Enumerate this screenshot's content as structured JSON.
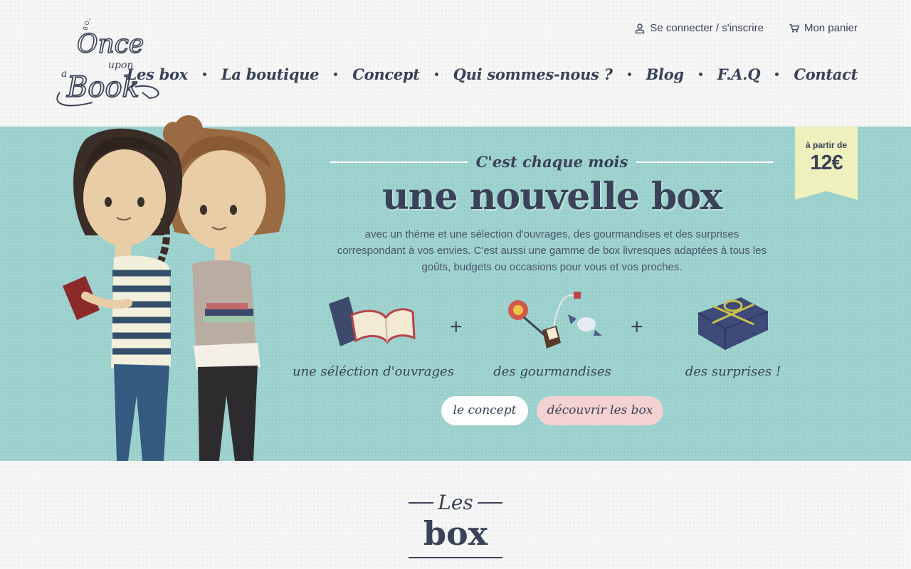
{
  "logo": {
    "tagline": "BOX LIVRESQUE",
    "line1": "Once",
    "line2": "upon",
    "line3": "a",
    "line4": "Book",
    "icon": "once-upon-a-book-logo"
  },
  "top_links": {
    "login": {
      "label": "Se connecter / s'inscrire",
      "icon": "user-icon"
    },
    "cart": {
      "label": "Mon panier",
      "icon": "cart-icon"
    }
  },
  "nav": [
    "Les box",
    "La boutique",
    "Concept",
    "Qui sommes-nous ?",
    "Blog",
    "F.A.Q",
    "Contact"
  ],
  "hero": {
    "price_prefix": "à partir de",
    "price": "12€",
    "kicker": "C'est chaque mois",
    "title": "une nouvelle box",
    "description": "avec un thème et une sélection d'ouvrages, des gourmandises et des surprises correspondant à vos envies. C'est aussi une gamme de box livresques adaptées à tous les goûts, budgets ou occasions pour vous et vos proches.",
    "features": [
      {
        "caption": "une séléction d'ouvrages",
        "icon": "books-icon"
      },
      {
        "caption": "des gourmandises",
        "icon": "candy-icon"
      },
      {
        "caption": "des surprises !",
        "icon": "gift-icon"
      }
    ],
    "plus": "+",
    "buttons": {
      "concept": "le concept",
      "discover": "découvrir les box"
    }
  },
  "section": {
    "kicker": "Les",
    "title": "box"
  },
  "colors": {
    "primary": "#3a4257",
    "hero_bg": "#9fd3cf",
    "ribbon": "#eef0bd",
    "button_pink": "#f3d2d1"
  }
}
